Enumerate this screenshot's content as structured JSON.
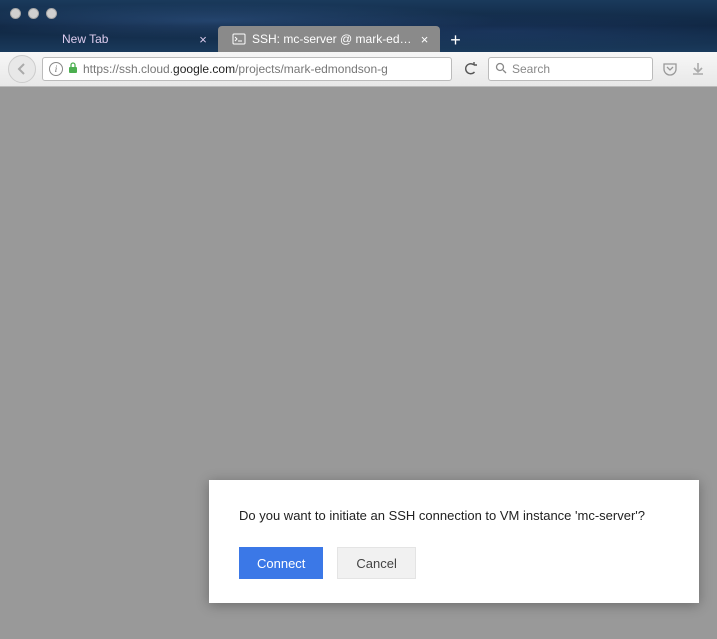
{
  "tabs": [
    {
      "label": "New Tab"
    },
    {
      "label": "SSH: mc-server @ mark-ed…"
    }
  ],
  "url": {
    "prefix": "https://ssh.cloud.",
    "domain": "google.com",
    "path": "/projects/mark-edmondson-g"
  },
  "search": {
    "placeholder": "Search"
  },
  "dialog": {
    "message": "Do you want to initiate an SSH connection to VM instance 'mc-server'?",
    "connect_label": "Connect",
    "cancel_label": "Cancel"
  }
}
